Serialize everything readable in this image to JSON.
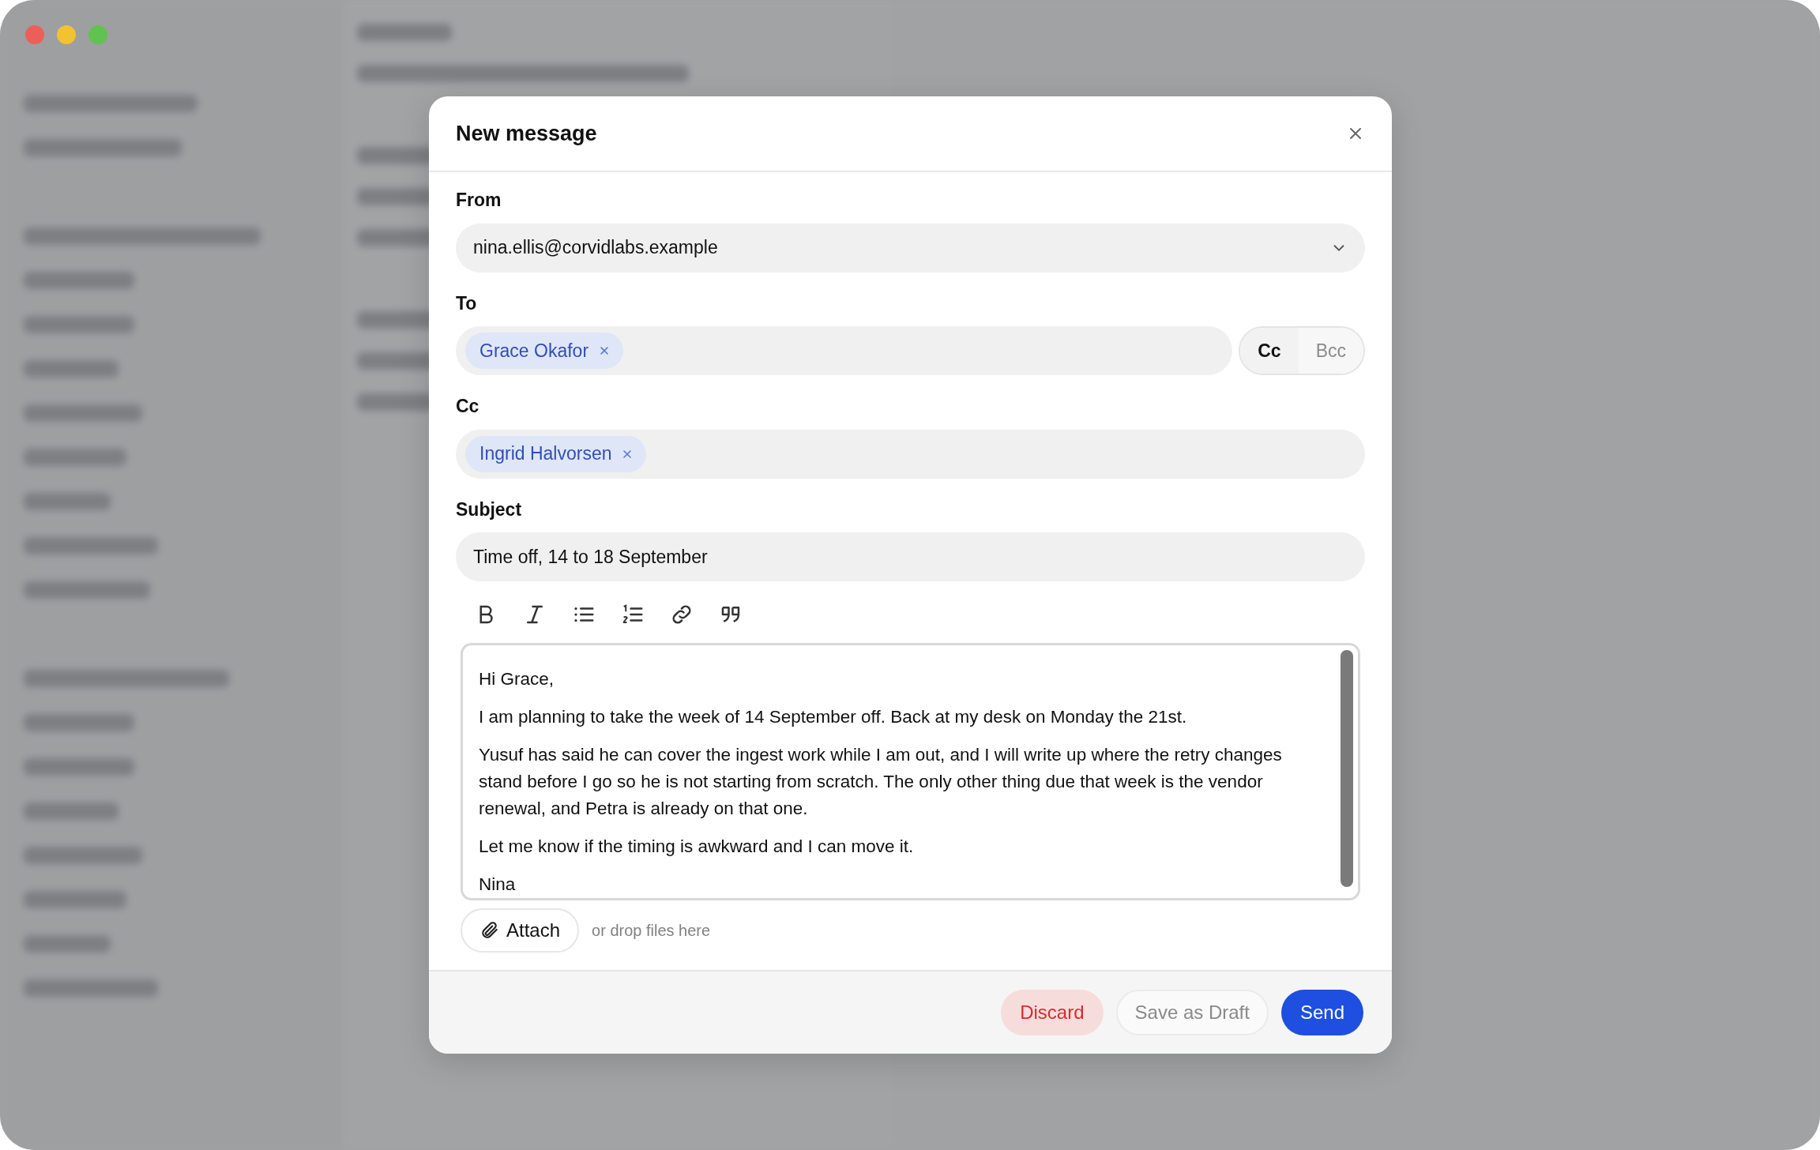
{
  "dialog": {
    "title": "New message",
    "from": {
      "label": "From",
      "value": "nina.ellis@corvidlabs.example"
    },
    "to": {
      "label": "To",
      "recipients": [
        {
          "name": "Grace Okafor"
        }
      ],
      "toggles": [
        {
          "label": "Cc",
          "selected": true
        },
        {
          "label": "Bcc",
          "selected": false
        }
      ]
    },
    "cc": {
      "label": "Cc",
      "recipients": [
        {
          "name": "Ingrid Halvorsen"
        }
      ]
    },
    "subject": {
      "label": "Subject",
      "value": "Time off, 14 to 18 September"
    },
    "toolbar": [
      {
        "kind": "bold"
      },
      {
        "kind": "italic"
      },
      {
        "kind": "bullets"
      },
      {
        "kind": "numbers"
      },
      {
        "kind": "link"
      },
      {
        "kind": "quote"
      }
    ],
    "body": [
      "Hi Grace,",
      "I am planning to take the week of 14 September off. Back at my desk on Monday the 21st.",
      "Yusuf has said he can cover the ingest work while I am out, and I will write up where the retry changes stand before I go so he is not starting from scratch. The only other thing due that week is the vendor renewal, and Petra is already on that one.",
      "Let me know if the timing is awkward and I can move it.",
      "Nina"
    ],
    "attach": {
      "button": "Attach",
      "hint": "or drop files here"
    },
    "buttons": [
      {
        "label": "Discard",
        "kind": "danger"
      },
      {
        "label": "Save as Draft",
        "kind": "secondary"
      },
      {
        "label": "Send",
        "kind": "primary"
      }
    ]
  }
}
